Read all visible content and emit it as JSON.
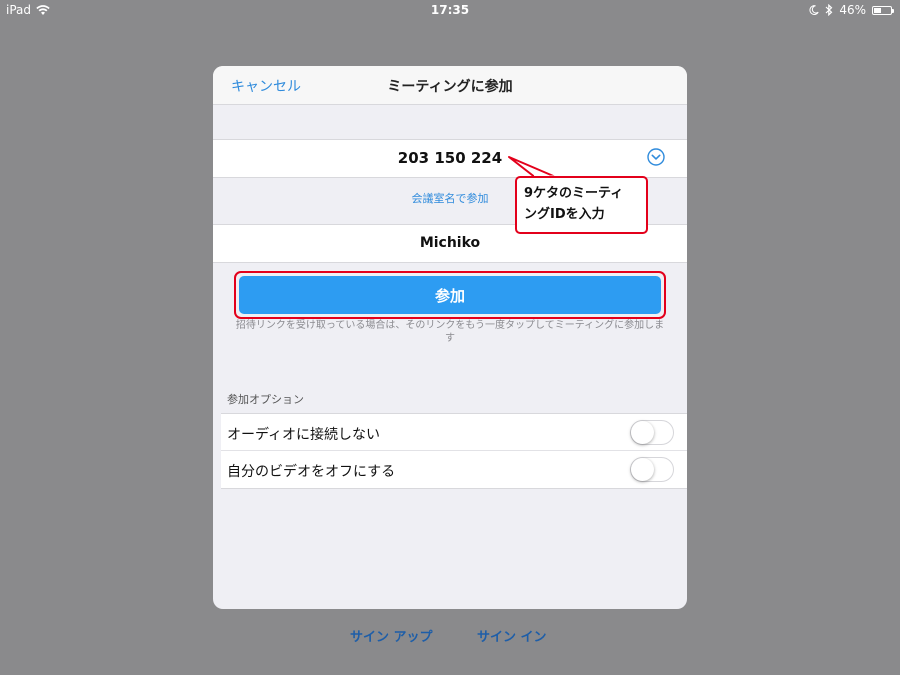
{
  "status_bar": {
    "device": "iPad",
    "time": "17:35",
    "battery": "46%",
    "battery_level": 0.46
  },
  "modal": {
    "cancel_label": "キャンセル",
    "title": "ミーティングに参加",
    "meeting_id": "203 150 224",
    "room_name_link": "会議室名で参加",
    "user_name": "Michiko",
    "join_button_label": "参加",
    "join_note": "招待リンクを受け取っている場合は、そのリンクをもう一度タップしてミーティングに参加します",
    "options_header": "参加オプション",
    "options": [
      {
        "label": "オーディオに接続しない",
        "enabled": false
      },
      {
        "label": "自分のビデオをオフにする",
        "enabled": false
      }
    ]
  },
  "annotation": {
    "callout_line1": "9ケタのミーティ",
    "callout_line2": "ングIDを入力",
    "highlight_color": "#e3001b"
  },
  "bottom_links": {
    "signup": "サイン アップ",
    "signin": "サイン イン"
  },
  "colors": {
    "accent": "#2d9cf2",
    "link": "#2f8bdc",
    "backdrop": "#8a8a8c"
  },
  "icons": {
    "wifi": "wifi-icon",
    "moon": "moon-icon",
    "bluetooth": "bluetooth-icon",
    "battery": "battery-icon",
    "dropdown": "chevron-down-circle-icon"
  }
}
